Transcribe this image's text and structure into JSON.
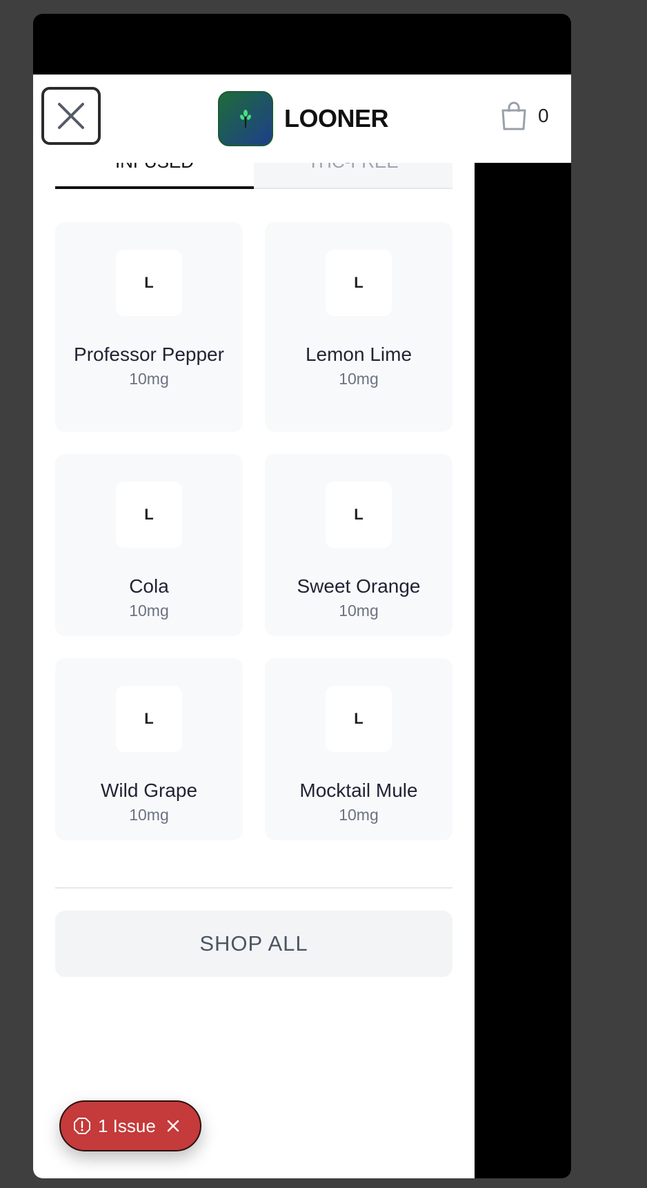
{
  "header": {
    "brand_name": "LOONER",
    "cart_count": "0"
  },
  "tabs": [
    {
      "label": "INFUSED",
      "active": true
    },
    {
      "label": "THC-FREE",
      "active": false
    }
  ],
  "products": [
    {
      "thumb": "L",
      "name": "Professor Pepper",
      "dose": "10mg"
    },
    {
      "thumb": "L",
      "name": "Lemon Lime",
      "dose": "10mg"
    },
    {
      "thumb": "L",
      "name": "Cola",
      "dose": "10mg"
    },
    {
      "thumb": "L",
      "name": "Sweet Orange",
      "dose": "10mg"
    },
    {
      "thumb": "L",
      "name": "Wild Grape",
      "dose": "10mg"
    },
    {
      "thumb": "L",
      "name": "Mocktail Mule",
      "dose": "10mg"
    }
  ],
  "shop_all_label": "SHOP ALL",
  "issue_badge": {
    "label": "1 Issue"
  },
  "colors": {
    "accent_red": "#c53a3a",
    "card_bg": "#f8f9fb"
  }
}
